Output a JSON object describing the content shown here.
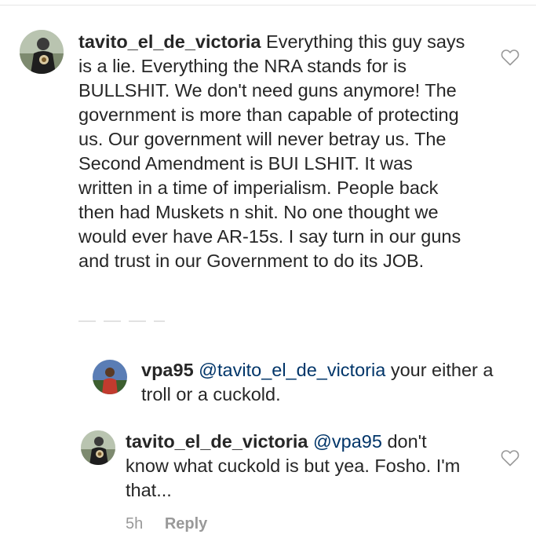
{
  "comments": [
    {
      "username": "tavito_el_de_victoria",
      "text": "Everything this guy says is a lie. Everything the NRA stands for is BULLSHIT.  We don't need guns anymore! The government is more than capable of protecting us. Our government will never betray us. The Second Amendment is BUI LSHIT. It was written in a time of imperialism. People back then had Muskets n shit. No one thought we would ever have AR-15s. I say turn in our guns and trust in our Government to do its JOB.",
      "avatar_icon": "user-avatar-icon",
      "like_icon": "heart-outline-icon"
    }
  ],
  "replies": [
    {
      "username": "vpa95",
      "mention": "@tavito_el_de_victoria",
      "text": "your either a troll or a cuckold.",
      "avatar_icon": "user-avatar-icon"
    },
    {
      "username": "tavito_el_de_victoria",
      "mention": "@vpa95",
      "text": "don't know what cuckold is but yea. Fosho. I'm that...",
      "avatar_icon": "user-avatar-icon",
      "like_icon": "heart-outline-icon",
      "time": "5h",
      "reply_label": "Reply"
    }
  ],
  "colors": {
    "text": "#262626",
    "mention": "#003569",
    "meta": "#999999"
  }
}
